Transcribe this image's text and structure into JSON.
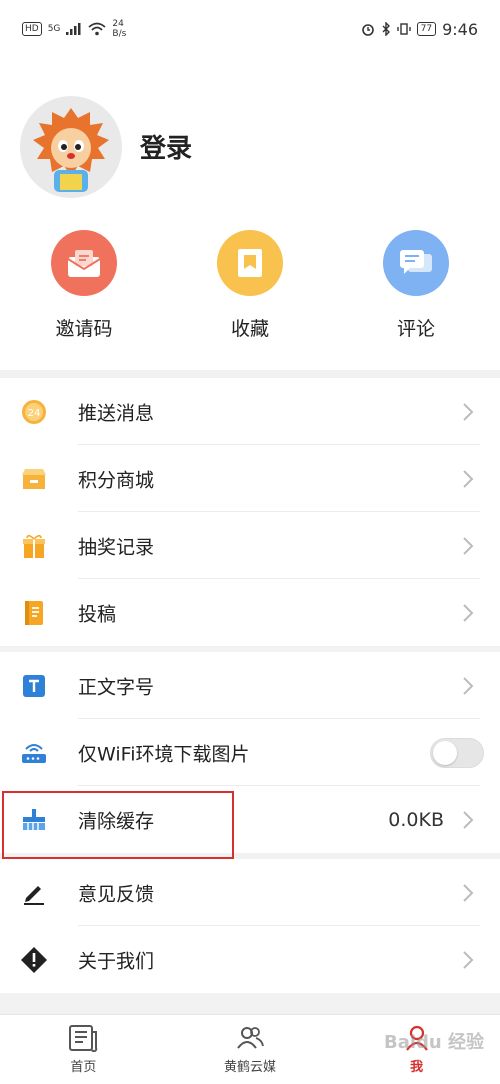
{
  "status_bar": {
    "left_badge": "HD",
    "signal_label": "5G",
    "net_speed_value": "24",
    "net_speed_unit": "B/s",
    "battery": "77",
    "time": "9:46"
  },
  "profile": {
    "login_label": "登录"
  },
  "quick_actions": [
    {
      "label": "邀请码",
      "color": "#f0725c"
    },
    {
      "label": "收藏",
      "color": "#f9c14d"
    },
    {
      "label": "评论",
      "color": "#7fb2f2"
    }
  ],
  "menu_group_1": [
    {
      "label": "推送消息",
      "icon": "badge-24-icon",
      "badge": "24"
    },
    {
      "label": "积分商城",
      "icon": "store-icon"
    },
    {
      "label": "抽奖记录",
      "icon": "gift-icon"
    },
    {
      "label": "投稿",
      "icon": "notebook-icon"
    }
  ],
  "menu_group_2": [
    {
      "label": "正文字号",
      "icon": "text-size-icon"
    },
    {
      "label": "仅WiFi环境下载图片",
      "icon": "router-icon",
      "toggle": "off"
    },
    {
      "label": "清除缓存",
      "icon": "broom-icon",
      "value": "0.0KB"
    }
  ],
  "menu_group_3": [
    {
      "label": "意见反馈",
      "icon": "pencil-icon"
    },
    {
      "label": "关于我们",
      "icon": "info-diamond-icon"
    }
  ],
  "bottom_nav": [
    {
      "label": "首页",
      "icon": "newspaper-icon"
    },
    {
      "label": "黄鹤云媒",
      "icon": "users-icon"
    },
    {
      "label": "我",
      "icon": "profile-icon",
      "active": true
    }
  ],
  "watermark": "Baidu 经验",
  "colors": {
    "accent": "#d6302f",
    "highlight_box": "#d6302f"
  }
}
